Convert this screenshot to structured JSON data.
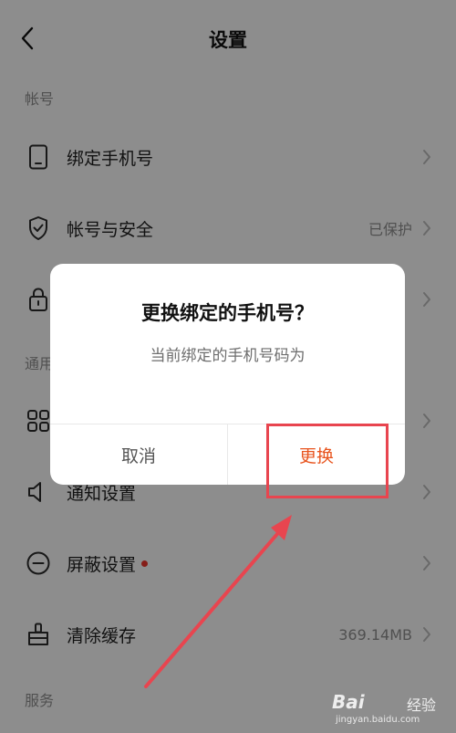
{
  "header": {
    "title": "设置"
  },
  "sections": {
    "account": "帐号",
    "general": "通用",
    "services": "服务"
  },
  "rows": [
    {
      "label": "绑定手机号",
      "value": "",
      "icon": "phone-icon"
    },
    {
      "label": "帐号与安全",
      "value": "已保护",
      "icon": "shield-icon"
    },
    {
      "label": "",
      "value": "",
      "icon": "lock-icon"
    },
    {
      "label": "",
      "value": "",
      "icon": "grid-icon"
    },
    {
      "label": "通知设置",
      "value": "",
      "icon": "speaker-icon"
    },
    {
      "label": "屏蔽设置",
      "value": "",
      "icon": "block-icon"
    },
    {
      "label": "清除缓存",
      "value": "369.14MB",
      "icon": "broom-icon"
    }
  ],
  "dialog": {
    "title": "更换绑定的手机号？",
    "message": "当前绑定的手机号码为",
    "cancel_label": "取消",
    "confirm_label": "更换"
  },
  "watermark": {
    "brand": "Bai",
    "text": "经验",
    "url": "jingyan.baidu.com"
  },
  "colors": {
    "accent": "#e8541e",
    "annotation": "#e8454f",
    "badge_dot": "#e6332a"
  }
}
